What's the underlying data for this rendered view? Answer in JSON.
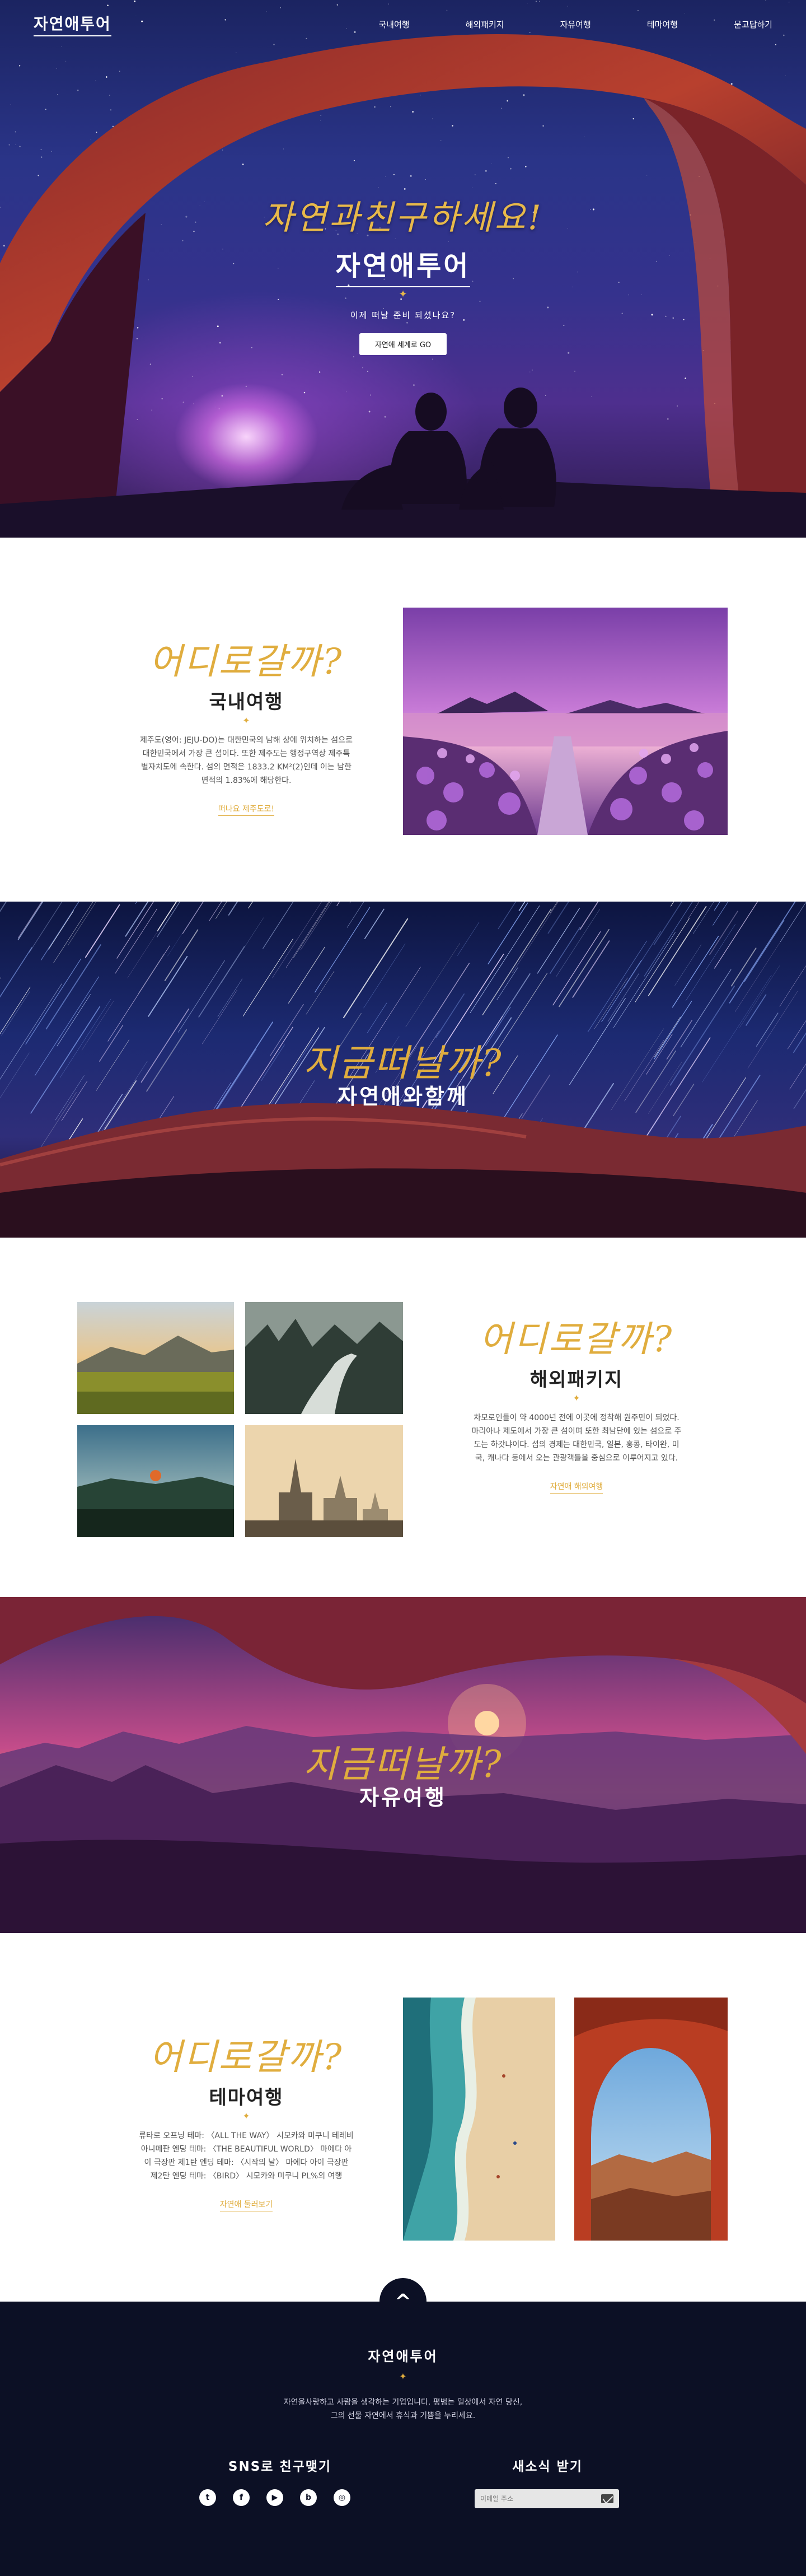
{
  "header": {
    "logo": "자연애투어",
    "nav": [
      "국내여행",
      "해외패키지",
      "자유여행",
      "테마여행",
      "묻고답하기"
    ]
  },
  "hero": {
    "script": "자연과친구하세요!",
    "title": "자연애투어",
    "subtitle": "이제 떠날 준비 되셨나요?",
    "button": "자연애 세계로 GO"
  },
  "domestic": {
    "script": "어디로갈까?",
    "title": "국내여행",
    "desc": [
      "제주도(영어: JEJU-DO)는 대한민국의 남해 상에 위치하는 섬으로",
      "대한민국에서 가장 큰 섬이다. 또한 제주도는 행정구역상 제주특",
      "별자치도에 속한다. 섬의 면적은 1833.2 KM²(2)인데 이는 남한",
      "면적의 1.83%에 해당한다."
    ],
    "link": "떠나요 제주도로!"
  },
  "banner1": {
    "script": "지금떠날까?",
    "title": "자연애와함께"
  },
  "overseas": {
    "script": "어디로갈까?",
    "title": "해외패키지",
    "desc": [
      "차모로인들이 약 4000년 전에 이곳에 정착해 원주민이 되었다.",
      "마리아나 제도에서 가장 큰 섬이며 또한 최남단에 있는 섬으로 주",
      "도는 하갓냐이다. 섬의 경제는 대한민국, 일본, 홍콩, 타이완, 미",
      "국, 캐나다 등에서 오는 관광객들을 중심으로 이루어지고 있다."
    ],
    "link": "자연애 해외여행"
  },
  "banner2": {
    "script": "지금떠날까?",
    "title": "자유여행"
  },
  "theme": {
    "script": "어디로갈까?",
    "title": "테마여행",
    "desc": [
      "류타로 오프닝 테마: 〈ALL THE WAY〉 시모카와 미쿠니 테레비",
      "아니메판 엔딩 테마: 〈THE BEAUTIFUL WORLD〉 마에다 아",
      "이 극장판 제1탄 엔딩 테마: 〈시작의 날〉 마에다 아이 극장판",
      "제2탄 엔딩 테마: 〈BIRD〉 시모카와 미쿠니 PL%의 여행"
    ],
    "link": "자연애 둘러보기"
  },
  "footer": {
    "top_button": "^",
    "title": "자연애투어",
    "desc": [
      "자연을사랑하고 사람을 생각하는 기업입니다. 평범는 일상에서 자연 당신,",
      "그의 선물 자연에서 휴식과 기쁨을 누리세요."
    ],
    "sns_title": "SNS로 친구맺기",
    "sns_icons": [
      "twitter-icon",
      "facebook-icon",
      "youtube-icon",
      "blog-icon",
      "instagram-icon"
    ],
    "sns_glyphs": [
      "t",
      "f",
      "▶",
      "b",
      "◎"
    ],
    "news_title": "새소식 받기",
    "email_placeholder": "이메일 주소"
  }
}
